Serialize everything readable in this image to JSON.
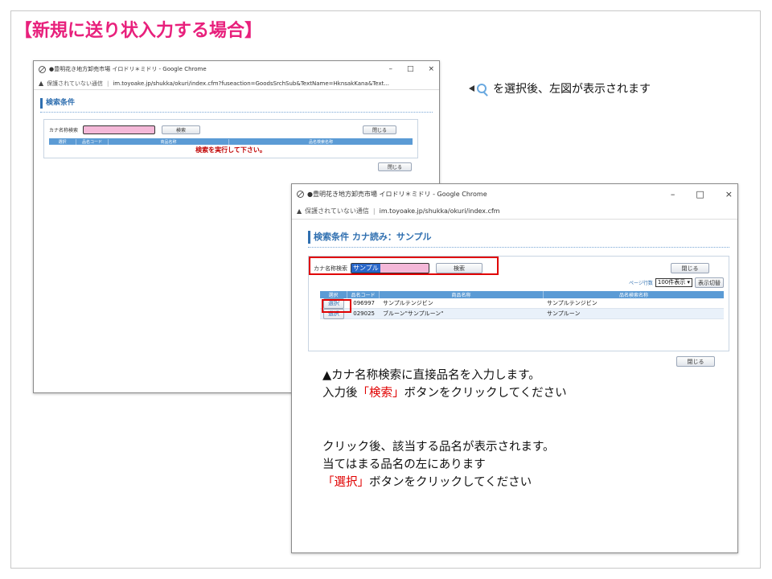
{
  "slide_title": "【新規に送り状入力する場合】",
  "window1": {
    "title": "●豊明花き地方卸売市場 イロドリ＊ミドリ - Google Chrome",
    "controls": [
      "–",
      "□",
      "×"
    ],
    "security": "保護されていない通信",
    "url": "im.toyoake.jp/shukka/okuri/index.cfm?fuseaction=GoodsSrchSub&TextName=HknsakKana&Text...",
    "section_title": "検索条件",
    "kana_label": "カナ名称検索",
    "search_btn": "検索",
    "close_btn": "閉じる",
    "close_btn_bottom": "閉じる",
    "table_headers": [
      "選択",
      "品名コード",
      "商品名称",
      "品名検索名称"
    ],
    "no_result": "検索を実行して下さい。"
  },
  "window2": {
    "title": "●豊明花き地方卸売市場 イロドリ＊ミドリ - Google Chrome",
    "controls": [
      "–",
      "□",
      "×"
    ],
    "security": "保護されていない通信",
    "url": "im.toyoake.jp/shukka/okuri/index.cfm",
    "section_title": "検索条件 カナ読み：サンプル",
    "kana_label": "カナ名称検索",
    "kana_value": "サンプル",
    "search_btn": "検索",
    "close_btn": "閉じる",
    "close_btn_bottom": "閉じる",
    "page_rows_label": "ページ行数",
    "page_rows_value": "100件表示 ▾",
    "page_switch_btn": "表示切替",
    "table_headers": [
      "選択",
      "品名コード",
      "商品名称",
      "品名検索名称"
    ],
    "rows": [
      {
        "select": "選択",
        "code": "096997",
        "name": "サンプルテンジビン",
        "search_name": "サンプルテンジビン"
      },
      {
        "select": "選択",
        "code": "029025",
        "name": "ブルーン\"サンプルーン\"",
        "search_name": "サンプルーン"
      }
    ]
  },
  "note_right": "を選択後、左図が表示されます",
  "instruction1": {
    "line1": "▲カナ名称検索に直接品名を入力します。",
    "line2_pre": "入力後",
    "line2_red": "「検索」",
    "line2_post": "ボタンをクリックしてください"
  },
  "instruction2": {
    "line1": "クリック後、該当する品名が表示されます。",
    "line2": "当てはまる品名の左にあります",
    "line3_red": "「選択」",
    "line3_post": "ボタンをクリックしてください"
  },
  "colors": {
    "title_pink": "#e8207c",
    "accent_blue": "#2f6fb0",
    "header_blue": "#5b9bd5",
    "highlight_red": "#e00000",
    "input_pink": "#f4b8d8"
  }
}
